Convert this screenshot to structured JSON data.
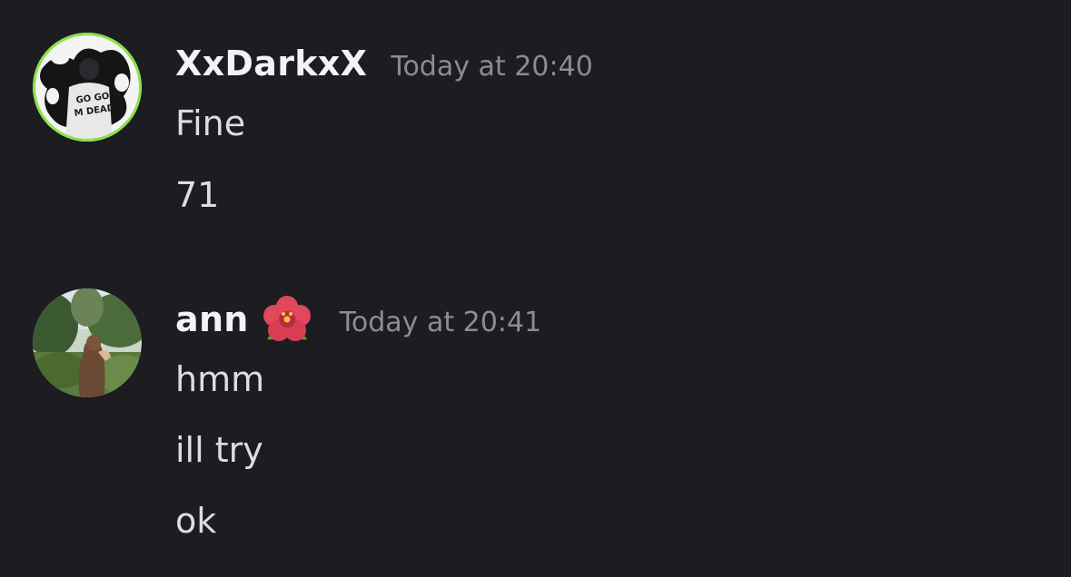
{
  "messages": [
    {
      "username": "XxDarkxX",
      "timestamp": "Today at 20:40",
      "lines": [
        "Fine",
        "71"
      ],
      "avatar_ring_color": "#8ce04a"
    },
    {
      "username": "ann",
      "username_emoji": "hibiscus-icon",
      "timestamp": "Today at 20:41",
      "lines": [
        "hmm",
        "ill try",
        "ok"
      ]
    }
  ],
  "colors": {
    "background": "#1c1c21",
    "username": "#f2f3f5",
    "timestamp": "#8a8c96",
    "message_text": "#dcdde2"
  }
}
